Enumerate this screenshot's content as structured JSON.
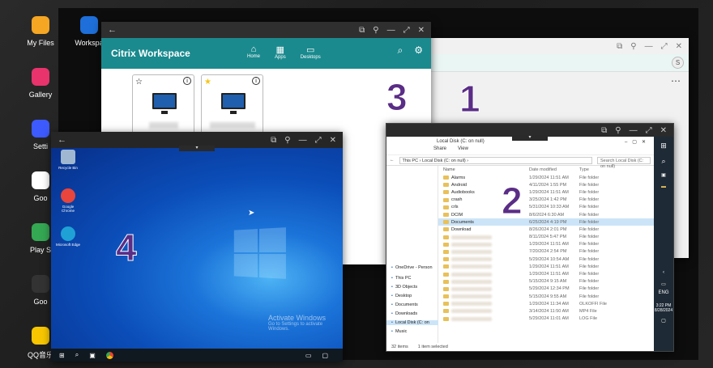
{
  "dock": [
    {
      "label": "My Files",
      "color": "#f5a623",
      "icon": "folder-icon"
    },
    {
      "label": "Workspa",
      "color": "#1e6fd9",
      "icon": "citrix-icon"
    },
    {
      "label": "Gallery",
      "color": "#e8336d",
      "icon": "flower-icon"
    },
    {
      "label": "Setti",
      "color": "#3d5afe",
      "icon": "gear-icon"
    },
    {
      "label": "Goo",
      "color": "#ffffff",
      "icon": "chrome-icon"
    },
    {
      "label": "Play S",
      "color": "#34a853",
      "icon": "play-icon"
    },
    {
      "label": "Goo",
      "color": "#333333",
      "icon": "google-apps-icon"
    },
    {
      "label": "QQ音乐",
      "color": "#f7c600",
      "icon": "qq-music-icon"
    }
  ],
  "win1": {
    "number": "1",
    "avatar": "S",
    "more": "⋯"
  },
  "win2": {
    "number": "2",
    "title": "Local Disk (C: on null)",
    "menu": [
      "Share",
      "View"
    ],
    "address": "This PC  ›  Local Disk (C: on null)  ›",
    "search_placeholder": "Search Local Disk (C: on null)",
    "col_name": "Name",
    "col_date": "Date modified",
    "col_type": "Type",
    "files": [
      {
        "name": "Alarms",
        "date": "1/29/2024 11:51 AM",
        "type": "File folder"
      },
      {
        "name": "Android",
        "date": "4/11/2024 1:55 PM",
        "type": "File folder"
      },
      {
        "name": "Audiobooks",
        "date": "1/29/2024 11:51 AM",
        "type": "File folder"
      },
      {
        "name": "crash",
        "date": "3/25/2024 1:42 PM",
        "type": "File folder"
      },
      {
        "name": "crls",
        "date": "5/31/2024 10:33 AM",
        "type": "File folder"
      },
      {
        "name": "DCIM",
        "date": "8/6/2024 6:30 AM",
        "type": "File folder"
      },
      {
        "name": "Documents",
        "date": "6/25/2024 4:19 PM",
        "type": "File folder"
      },
      {
        "name": "Download",
        "date": "8/26/2024 2:01 PM",
        "type": "File folder"
      },
      {
        "name": "",
        "date": "8/11/2024 5:47 PM",
        "type": "File folder"
      },
      {
        "name": "",
        "date": "1/29/2024 11:51 AM",
        "type": "File folder"
      },
      {
        "name": "",
        "date": "7/20/2024 2:54 PM",
        "type": "File folder"
      },
      {
        "name": "",
        "date": "5/29/2024 10:54 AM",
        "type": "File folder"
      },
      {
        "name": "",
        "date": "1/29/2024 11:51 AM",
        "type": "File folder"
      },
      {
        "name": "",
        "date": "1/29/2024 11:51 AM",
        "type": "File folder"
      },
      {
        "name": "",
        "date": "5/15/2024 9:15 AM",
        "type": "File folder"
      },
      {
        "name": "",
        "date": "5/29/2024 12:34 PM",
        "type": "File folder"
      },
      {
        "name": "",
        "date": "5/15/2024 9:55 AM",
        "type": "File folder"
      },
      {
        "name": "",
        "date": "1/29/2024 11:34 AM",
        "type": "OLKOFFI File"
      },
      {
        "name": "",
        "date": "3/14/2024 11:50 AM",
        "type": "MP4 File"
      },
      {
        "name": "",
        "date": "5/29/2024 11:01 AM",
        "type": "LOG File"
      }
    ],
    "nav": [
      "OneDrive - Person",
      "This PC",
      "3D Objects",
      "Desktop",
      "Documents",
      "Downloads",
      "Local Disk (C: on",
      "Music"
    ],
    "status_count": "32 items",
    "status_sel": "1 item selected",
    "tray_time": "3:22 PM",
    "tray_date": "8/28/2024",
    "tray_lang": "ENG"
  },
  "win3": {
    "number": "3",
    "title": "Citrix Workspace",
    "nav": [
      {
        "label": "Home",
        "glyph": "⌂"
      },
      {
        "label": "Apps",
        "glyph": "▦"
      },
      {
        "label": "Desktops",
        "glyph": "▭"
      }
    ],
    "cards": [
      {
        "star": "☆"
      },
      {
        "star": "★"
      }
    ]
  },
  "win4": {
    "number": "4",
    "desktop_icons": [
      {
        "label": "Recycle Bin",
        "color": "#9fb7d0"
      },
      {
        "label": "Google Chrome",
        "color": "#e8453c"
      },
      {
        "label": "Microsoft Edge",
        "color": "#1fa1d6"
      }
    ],
    "activate_title": "Activate Windows",
    "activate_sub": "Go to Settings to activate Windows."
  }
}
